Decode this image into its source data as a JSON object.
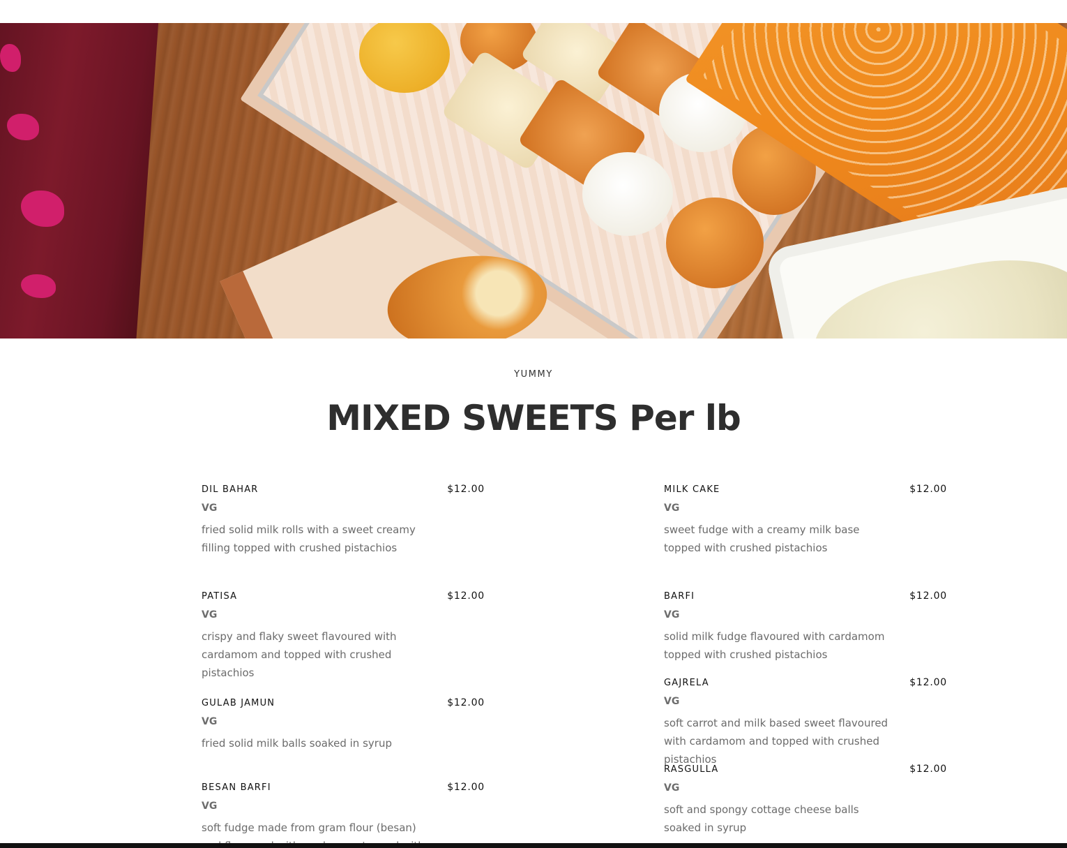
{
  "hero": {
    "image_alt": "box of assorted Indian sweets"
  },
  "section": {
    "eyebrow": "YUMMY",
    "title": "MIXED SWEETS Per lb"
  },
  "menu": {
    "left": [
      {
        "name": "DIL BAHAR",
        "price": "$12.00",
        "tag": "VG",
        "desc": "fried solid milk rolls with a sweet creamy filling topped with crushed pistachios"
      },
      {
        "name": "PATISA",
        "price": "$12.00",
        "tag": "VG",
        "desc": "crispy and flaky sweet flavoured with cardamom and topped with crushed pistachios"
      },
      {
        "name": "GULAB JAMUN",
        "price": "$12.00",
        "tag": "VG",
        "desc": "fried solid milk balls soaked in syrup"
      },
      {
        "name": "BESAN BARFI",
        "price": "$12.00",
        "tag": "VG",
        "desc": "soft fudge made from gram flour (besan) and flavoured with cardamom topped with crushed"
      }
    ],
    "right": [
      {
        "name": "MILK CAKE",
        "price": "$12.00",
        "tag": "VG",
        "desc": "sweet fudge with a creamy milk base topped with crushed pistachios"
      },
      {
        "name": "BARFI",
        "price": "$12.00",
        "tag": "VG",
        "desc": "solid milk fudge flavoured with cardamom topped with crushed pistachios"
      },
      {
        "name": "GAJRELA",
        "price": "$12.00",
        "tag": "VG",
        "desc": "soft carrot and milk based sweet flavoured with cardamom and topped with crushed pistachios"
      },
      {
        "name": "RASGULLA",
        "price": "$12.00",
        "tag": "VG",
        "desc": "soft and spongy cottage cheese balls soaked in syrup"
      }
    ]
  }
}
